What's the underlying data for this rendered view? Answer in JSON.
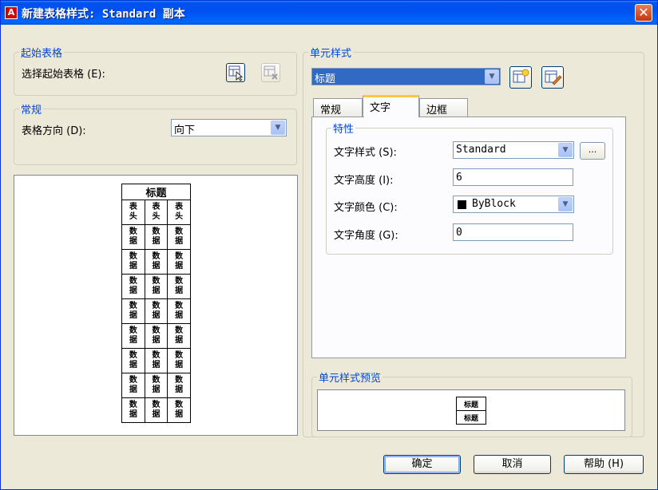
{
  "window": {
    "title": "新建表格样式: Standard 副本",
    "close_glyph": "✕"
  },
  "start_table": {
    "legend": "起始表格",
    "select_label": "选择起始表格 (E):"
  },
  "general": {
    "legend": "常规",
    "direction_label": "表格方向 (D):",
    "direction_value": "向下"
  },
  "preview_table": {
    "title": "标题",
    "header_cell": "表头",
    "data_cell": "数据",
    "data_rows": 8,
    "columns": 3
  },
  "cell_styles": {
    "legend": "单元样式",
    "selected_style": "标题",
    "tabs": [
      "常规",
      "文字",
      "边框"
    ],
    "active_tab": "文字",
    "properties": {
      "legend": "特性",
      "text_style_label": "文字样式 (S):",
      "text_style_value": "Standard",
      "browse_label": "...",
      "text_height_label": "文字高度 (I):",
      "text_height_value": "6",
      "text_color_label": "文字颜色 (C):",
      "text_color_value": "ByBlock",
      "text_color_swatch": "#000000",
      "text_angle_label": "文字角度 (G):",
      "text_angle_value": "0"
    }
  },
  "cell_preview": {
    "legend": "单元样式预览",
    "sample_text": "标题"
  },
  "buttons": {
    "ok": "确定",
    "cancel": "取消",
    "help": "帮助 (H)"
  },
  "colors": {
    "legend_blue": "#0046d5",
    "selection_blue": "#316ac5",
    "dialog_bg": "#ece9d8"
  },
  "icons": {
    "start_table_pick": "table-pick-icon",
    "start_table_remove": "table-remove-icon",
    "new_cell_style": "new-cell-style-icon",
    "manage_cell_styles": "manage-cell-styles-icon"
  }
}
